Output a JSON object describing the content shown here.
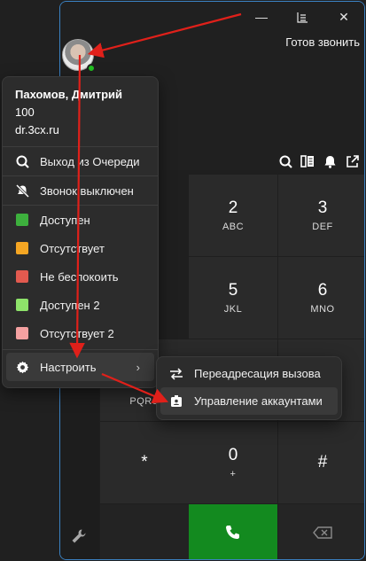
{
  "window": {
    "minimize": "—",
    "layout": "⊞",
    "close": "✕",
    "status": "Готов звонить"
  },
  "profile": {
    "name": "Пахомов, Дмитрий",
    "extension": "100",
    "domain": "dr.3cx.ru"
  },
  "menu": {
    "queue_logout": "Выход из Очереди",
    "ringer_off": "Звонок выключен",
    "statuses": [
      {
        "label": "Доступен",
        "color": "#3db03d"
      },
      {
        "label": "Отсутствует",
        "color": "#f5a623"
      },
      {
        "label": "Не беспокоить",
        "color": "#e25a4f"
      },
      {
        "label": "Доступен 2",
        "color": "#8ee36a"
      },
      {
        "label": "Отсутствует 2",
        "color": "#f4a1a1"
      }
    ],
    "settings": "Настроить",
    "chevron": "›"
  },
  "submenu": {
    "forwarding": "Переадресация вызова",
    "accounts": "Управление аккаунтами"
  },
  "keypad": {
    "k2": {
      "digit": "2",
      "letters": "ABC"
    },
    "k3": {
      "digit": "3",
      "letters": "DEF"
    },
    "k5": {
      "digit": "5",
      "letters": "JKL"
    },
    "k6": {
      "digit": "6",
      "letters": "MNO"
    },
    "k7_letters": "PQRS",
    "star": "*",
    "k0": {
      "digit": "0",
      "letters": "+"
    },
    "hash": "#"
  },
  "colors": {
    "accent_border": "#3b82c4",
    "call_green": "#138a1f",
    "presence_green": "#22c122",
    "annotation_red": "#e0201a"
  }
}
